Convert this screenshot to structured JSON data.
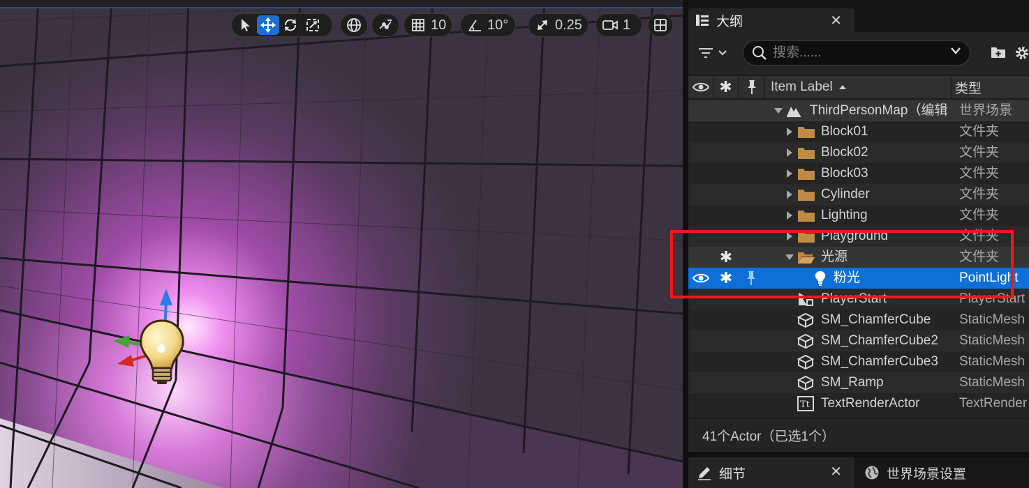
{
  "viewport": {
    "toolbar": {
      "grid_snap_value": "10",
      "rotation_snap_value": "10°",
      "scale_snap_value": "0.25",
      "camera_speed_value": "1"
    }
  },
  "outliner": {
    "tab_title": "大纲",
    "search_placeholder": "搜索......",
    "columns": {
      "label": "Item Label",
      "type": "类型"
    },
    "rows": [
      {
        "label": "ThirdPersonMap（编辑",
        "type": "世界场景"
      },
      {
        "label": "Block01",
        "type": "文件夹"
      },
      {
        "label": "Block02",
        "type": "文件夹"
      },
      {
        "label": "Block03",
        "type": "文件夹"
      },
      {
        "label": "Cylinder",
        "type": "文件夹"
      },
      {
        "label": "Lighting",
        "type": "文件夹"
      },
      {
        "label": "Playground",
        "type": "文件夹"
      },
      {
        "label": "光源",
        "type": "文件夹"
      },
      {
        "label": "粉光",
        "type": "PointLight"
      },
      {
        "label": "PlayerStart",
        "type": "PlayerStart"
      },
      {
        "label": "SM_ChamferCube",
        "type": "StaticMesh"
      },
      {
        "label": "SM_ChamferCube2",
        "type": "StaticMesh"
      },
      {
        "label": "SM_ChamferCube3",
        "type": "StaticMesh"
      },
      {
        "label": "SM_Ramp",
        "type": "StaticMesh"
      },
      {
        "label": "TextRenderActor",
        "type": "TextRender"
      }
    ],
    "status": "41个Actor（已选1个）"
  },
  "bottom_tabs": {
    "details": "细节",
    "world_settings": "世界场景设置"
  },
  "colors": {
    "selection": "#0c70d8",
    "highlight_box": "#ff1515",
    "folder": "#c08a45"
  }
}
